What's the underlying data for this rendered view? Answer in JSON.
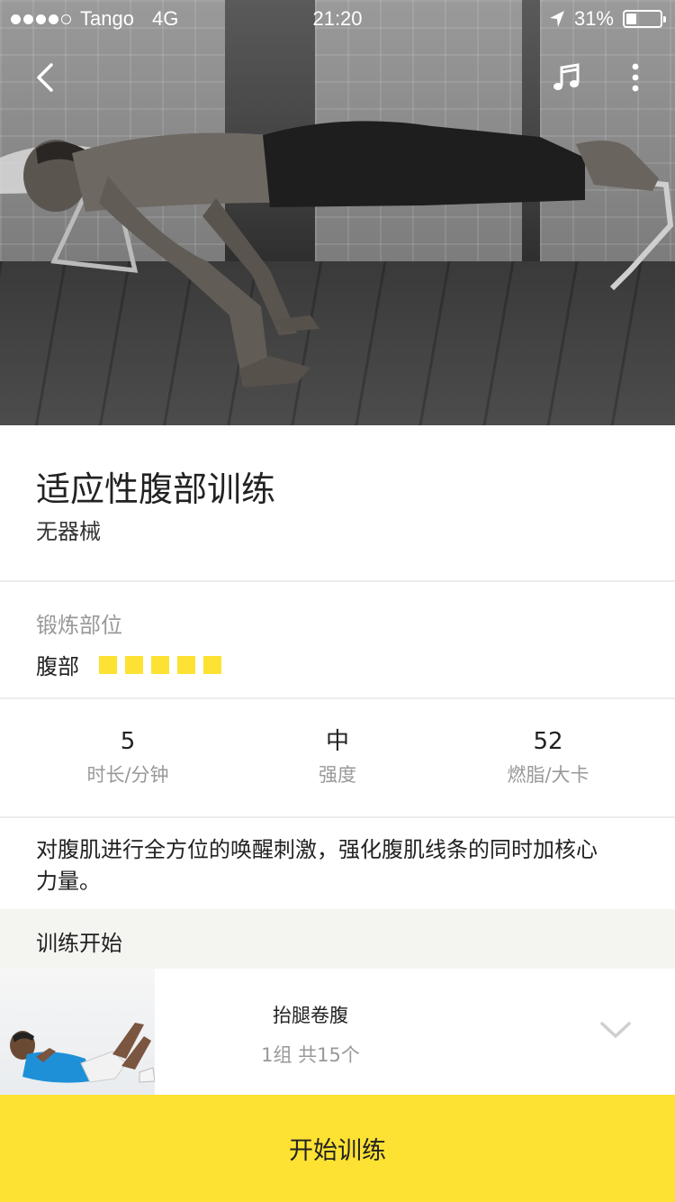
{
  "status_bar": {
    "carrier": "Tango",
    "network": "4G",
    "time": "21:20",
    "battery": "31%",
    "battery_level": 0.31,
    "signal_bars_filled": 4,
    "signal_bars_total": 5
  },
  "nav": {
    "back_icon": "chevron-left-icon",
    "music_icon": "music-note-icon",
    "more_icon": "more-vertical-icon"
  },
  "course": {
    "title": "适应性腹部训练",
    "equipment": "无器械"
  },
  "target": {
    "label": "锻炼部位",
    "value": "腹部",
    "level_filled": 5,
    "level_total": 5,
    "level_color": "#fee233"
  },
  "stats": [
    {
      "value": "5",
      "label": "时长/分钟"
    },
    {
      "value": "中",
      "label": "强度"
    },
    {
      "value": "52",
      "label": "燃脂/大卡"
    }
  ],
  "description": "对腹肌进行全方位的唤醒刺激，强化腹肌线条的同时加核心力量。",
  "section": {
    "title": "训练开始"
  },
  "exercises": [
    {
      "name": "抬腿卷腹",
      "sets": "1组 共15个",
      "expand_icon": "chevron-down-icon"
    }
  ],
  "start_button": {
    "label": "开始训练",
    "color": "#fee233"
  }
}
